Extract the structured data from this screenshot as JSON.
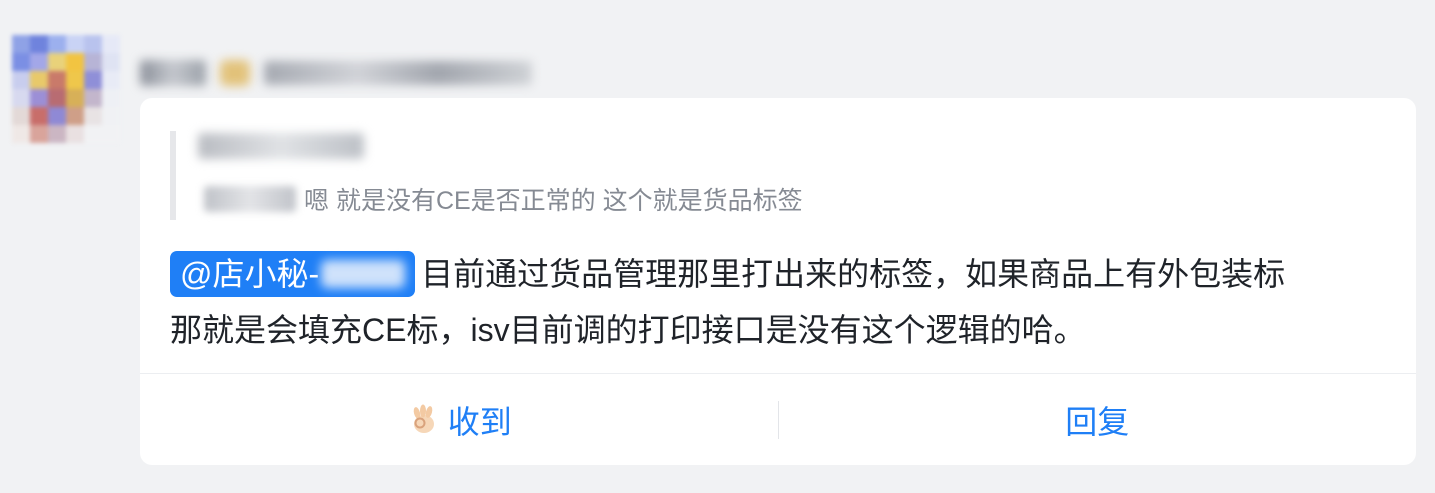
{
  "message": {
    "quote": {
      "text": "嗯 就是没有CE是否正常的 这个就是货品标签"
    },
    "mention_label": "@店小秘-",
    "body_line1": "目前通过货品管理那里打出来的标签，如果商品上有外包装标",
    "body_line2": "那就是会填充CE标，isv目前调的打印接口是没有这个逻辑的哈。"
  },
  "actions": {
    "ack_label": "收到",
    "ack_icon": "ok-hand-icon",
    "reply_label": "回复"
  },
  "colors": {
    "accent": "#1f7ff6",
    "background": "#f1f2f4",
    "card": "#ffffff",
    "quote_text": "#858a93",
    "body_text": "#1f2329"
  }
}
